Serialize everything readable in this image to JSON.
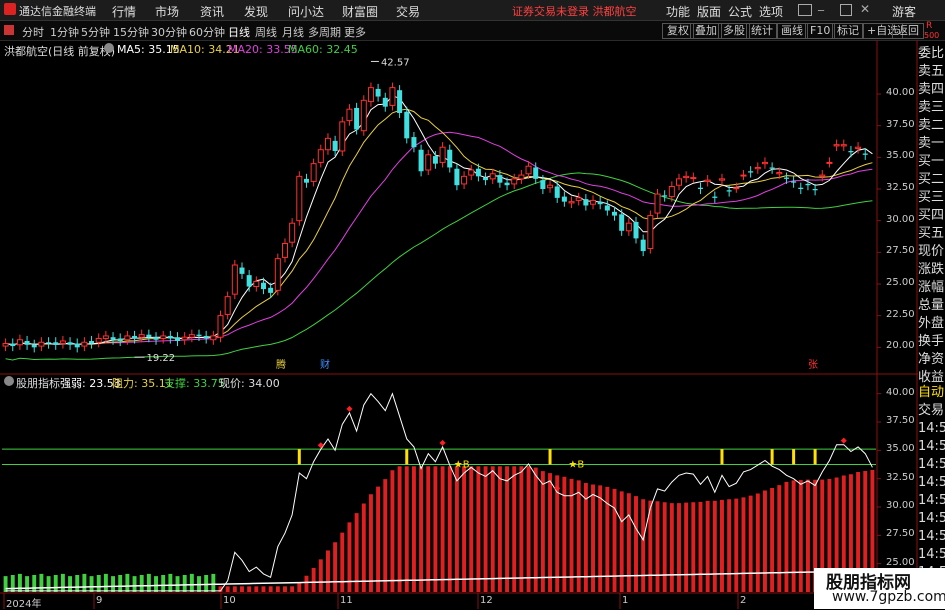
{
  "app": {
    "title": "通达信金融终端"
  },
  "menu": {
    "items": [
      "行情",
      "市场",
      "资讯",
      "发现",
      "问小达",
      "财富圈",
      "交易"
    ]
  },
  "notice": "证券交易未登录  洪都航空",
  "right_menu": {
    "items": [
      "功能",
      "版面",
      "公式",
      "选项"
    ]
  },
  "guest_label": "游客",
  "periods": [
    "分时",
    "1分钟",
    "5分钟",
    "15分钟",
    "30分钟",
    "60分钟",
    "日线",
    "周线",
    "月线",
    "多周期",
    "更多"
  ],
  "active_period": "日线",
  "toolbar": {
    "buttons": [
      "复权",
      "叠加",
      "多股",
      "统计",
      "画线",
      "F10",
      "标记",
      "+自选",
      "返回"
    ]
  },
  "right_corner": {
    "r": "R",
    "num": "500"
  },
  "main_chart": {
    "title": "洪都航空(日线 前复权)",
    "ma": [
      {
        "label": "MA5: 35.15",
        "color": "#ffffff"
      },
      {
        "label": "MA10: 34.21",
        "color": "#e8d040"
      },
      {
        "label": "MA20: 33.55",
        "color": "#e040e0"
      },
      {
        "label": "MA60: 32.45",
        "color": "#40d040"
      }
    ],
    "high_label": "42.57",
    "low_label": "19.22",
    "yticks": [
      "40.00",
      "37.50",
      "35.00",
      "32.50",
      "30.00",
      "27.50",
      "25.00",
      "22.50",
      "20.00"
    ],
    "markers": [
      "腾",
      "财",
      "张"
    ]
  },
  "sub_chart": {
    "title": "股朋指标",
    "strength": "强弱: 23.53",
    "resistance": "阻力: 35.11",
    "support": "支撑: 33.75",
    "price": "现价: 34.00",
    "yticks": [
      "40.00",
      "37.50",
      "35.00",
      "32.50",
      "30.00",
      "27.50",
      "25.00",
      "22.50"
    ],
    "b_labels": [
      "B",
      "B"
    ]
  },
  "xaxis": {
    "labels": [
      "2024年",
      "9",
      "10",
      "11",
      "12",
      "1",
      "2"
    ]
  },
  "right_tabs": [
    "委比",
    "卖五",
    "卖四",
    "卖三",
    "卖二",
    "卖一",
    "买一",
    "买二",
    "买三",
    "买四",
    "买五",
    "现价",
    "涨跌",
    "涨幅",
    "总量",
    "外盘",
    "换手",
    "净资",
    "收益"
  ],
  "right_tabs2": {
    "auto": "自动",
    "trade": "交易",
    "times": [
      "14:56",
      "14:56",
      "14:56",
      "14:56",
      "14:56",
      "14:56",
      "14:56",
      "14:56",
      "14:56"
    ]
  },
  "watermark": {
    "line1": "股朋指标网",
    "line2": "www.7gpzb.com"
  },
  "colors": {
    "up": "#ff3030",
    "down": "#40e0e0",
    "ma5": "#ffffff",
    "ma10": "#e8d040",
    "ma20": "#e040e0",
    "ma60": "#40d040"
  },
  "chart_data": {
    "type": "candlestick",
    "title": "洪都航空(日线 前复权)",
    "ylim": [
      19,
      43
    ],
    "close": [
      20.3,
      20.1,
      20.6,
      20.2,
      20.0,
      20.4,
      20.3,
      20.2,
      20.5,
      20.2,
      20.0,
      20.4,
      20.3,
      20.7,
      20.9,
      20.6,
      20.5,
      20.9,
      20.7,
      21.0,
      20.8,
      20.6,
      20.9,
      20.7,
      20.5,
      20.8,
      21.0,
      20.9,
      20.7,
      20.9,
      22.5,
      24.0,
      26.5,
      25.8,
      24.8,
      25.2,
      24.6,
      24.3,
      27.0,
      28.2,
      29.8,
      33.5,
      33.0,
      34.5,
      35.6,
      36.5,
      35.5,
      37.8,
      38.8,
      37.2,
      39.5,
      40.5,
      39.8,
      39.0,
      40.5,
      38.5,
      36.5,
      35.8,
      33.9,
      35.2,
      34.5,
      35.8,
      34.2,
      32.8,
      33.5,
      34.0,
      33.5,
      33.2,
      33.7,
      33.0,
      32.8,
      33.3,
      33.6,
      34.3,
      33.3,
      32.5,
      32.8,
      31.8,
      31.5,
      31.5,
      31.8,
      31.2,
      31.6,
      31.3,
      30.8,
      30.4,
      29.2,
      29.8,
      28.6,
      27.6,
      30.4,
      32.1,
      31.9,
      32.7,
      33.3,
      33.5,
      33.4,
      32.5,
      33.2,
      31.8,
      33.3,
      32.3,
      32.6,
      33.6,
      33.8,
      34.2,
      34.6,
      34.1,
      33.8,
      33.3,
      33.0,
      32.5,
      32.8,
      32.4,
      33.6,
      34.6,
      36.0,
      36.0,
      35.4,
      35.8,
      35.2,
      34.0
    ],
    "open": [
      20.1,
      20.3,
      20.2,
      20.5,
      20.2,
      20.1,
      20.4,
      20.4,
      20.3,
      20.4,
      20.3,
      20.1,
      20.5,
      20.4,
      20.7,
      20.8,
      20.7,
      20.6,
      20.9,
      20.8,
      21.0,
      20.8,
      20.7,
      20.9,
      20.8,
      20.6,
      20.8,
      21.0,
      20.9,
      20.6,
      20.8,
      22.6,
      24.2,
      26.3,
      25.7,
      24.8,
      25.1,
      24.7,
      24.5,
      27.1,
      28.3,
      30.0,
      33.3,
      33.1,
      34.6,
      35.6,
      36.3,
      35.5,
      37.9,
      38.9,
      37.1,
      39.4,
      40.4,
      39.7,
      39.1,
      40.3,
      38.6,
      36.6,
      35.6,
      34.0,
      35.1,
      34.6,
      35.6,
      34.1,
      32.9,
      33.6,
      34.1,
      33.4,
      33.3,
      33.6,
      33.0,
      32.9,
      33.3,
      33.7,
      34.2,
      33.2,
      32.6,
      32.7,
      31.9,
      31.4,
      31.6,
      31.7,
      31.3,
      31.5,
      31.2,
      30.7,
      30.5,
      29.2,
      29.9,
      28.5,
      27.8,
      30.6,
      32.0,
      31.9,
      32.8,
      33.4,
      33.4,
      32.6,
      33.1,
      31.9,
      33.2,
      32.4,
      32.6,
      33.6,
      33.9,
      34.1,
      34.5,
      34.2,
      33.7,
      33.4,
      33.1,
      32.6,
      32.9,
      32.5,
      33.5,
      34.6,
      35.9,
      35.9,
      35.5,
      35.7,
      35.3
    ]
  }
}
